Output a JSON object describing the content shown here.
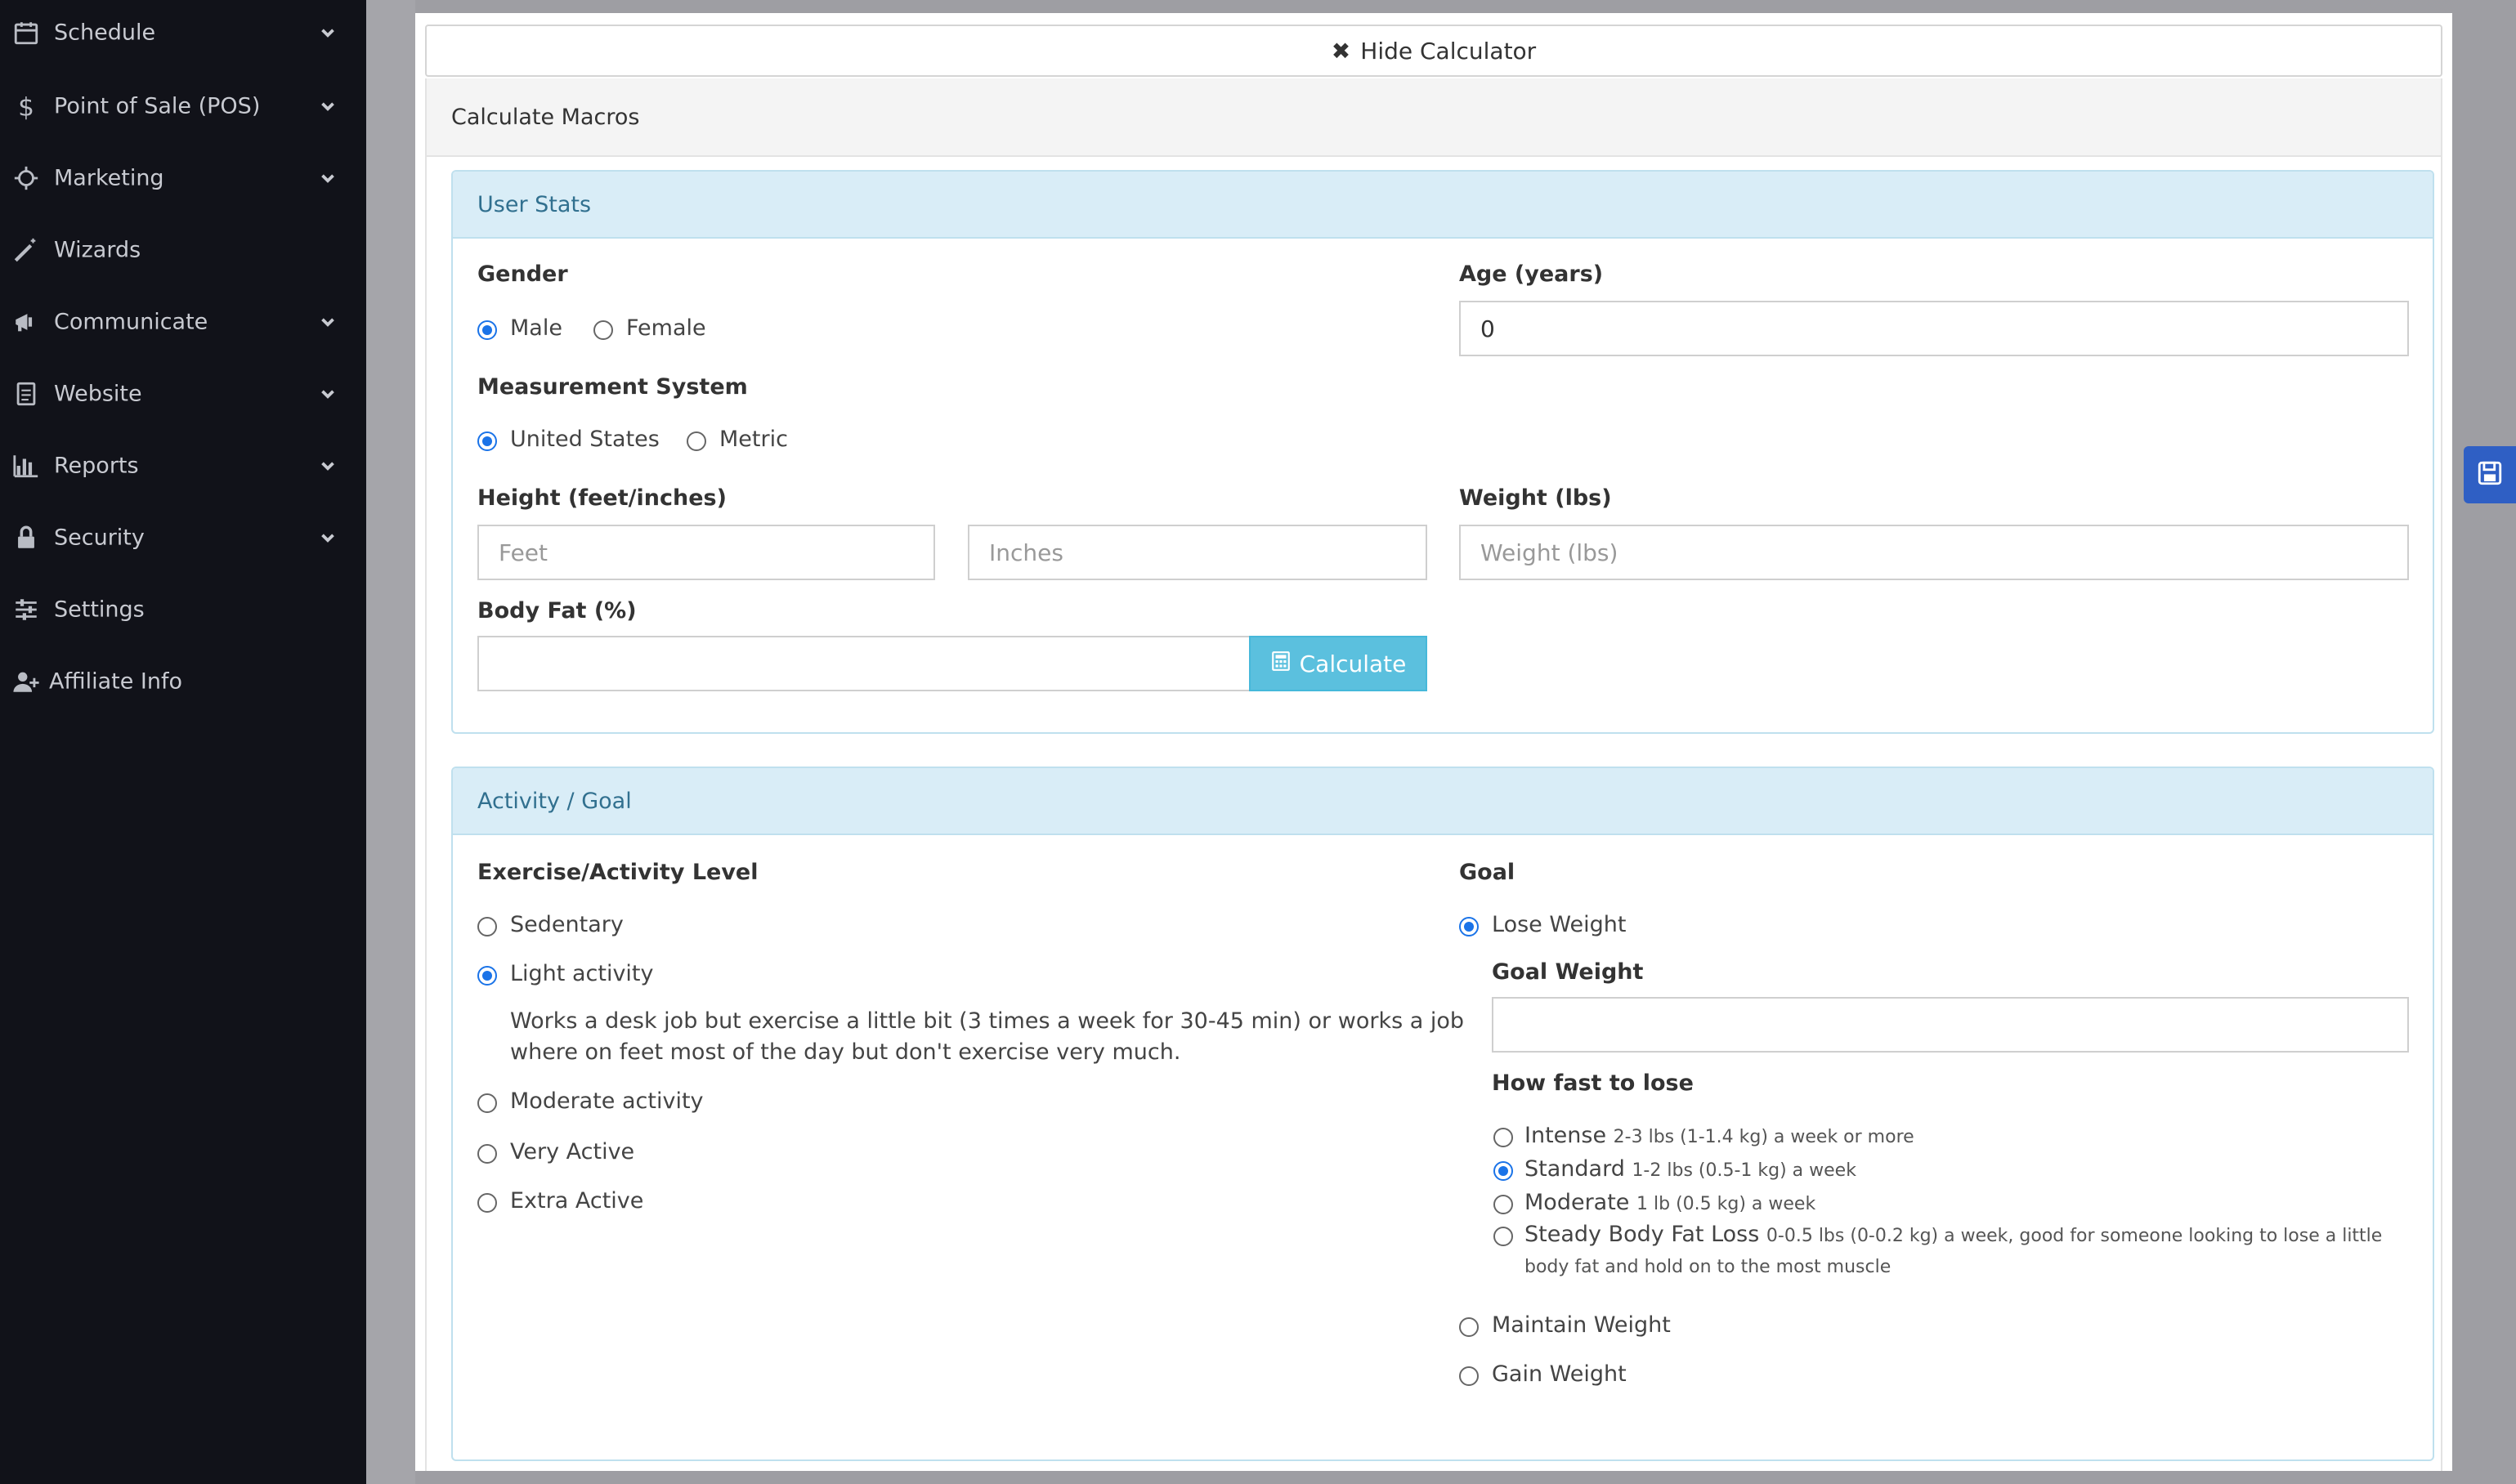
{
  "sidebar": {
    "items": [
      {
        "label": "Schedule",
        "icon": "calendar-icon",
        "has_chevron": true
      },
      {
        "label": "Point of Sale (POS)",
        "icon": "dollar-icon",
        "has_chevron": true
      },
      {
        "label": "Marketing",
        "icon": "crosshair-icon",
        "has_chevron": true
      },
      {
        "label": "Wizards",
        "icon": "magic-wand-icon",
        "has_chevron": false
      },
      {
        "label": "Communicate",
        "icon": "megaphone-icon",
        "has_chevron": true
      },
      {
        "label": "Website",
        "icon": "document-icon",
        "has_chevron": true
      },
      {
        "label": "Reports",
        "icon": "bar-chart-icon",
        "has_chevron": true
      },
      {
        "label": "Security",
        "icon": "lock-icon",
        "has_chevron": true
      },
      {
        "label": "Settings",
        "icon": "sliders-icon",
        "has_chevron": false
      },
      {
        "label": "Affiliate Info",
        "icon": "user-plus-icon",
        "has_chevron": false
      }
    ]
  },
  "modal": {
    "hide_label": "Hide Calculator",
    "title": "Calculate Macros"
  },
  "user_stats": {
    "heading": "User Stats",
    "gender_label": "Gender",
    "gender_options": [
      "Male",
      "Female"
    ],
    "gender_selected": "Male",
    "age_label": "Age (years)",
    "age_value": "0",
    "measurement_label": "Measurement System",
    "measurement_options": [
      "United States",
      "Metric"
    ],
    "measurement_selected": "United States",
    "height_label": "Height (feet/inches)",
    "feet_placeholder": "Feet",
    "inches_placeholder": "Inches",
    "weight_label": "Weight (lbs)",
    "weight_placeholder": "Weight (lbs)",
    "bodyfat_label": "Body Fat (%)",
    "bodyfat_value": "",
    "calculate_label": "Calculate"
  },
  "activity": {
    "heading": "Activity / Goal",
    "level_label": "Exercise/Activity Level",
    "levels": [
      "Sedentary",
      "Light activity",
      "Moderate activity",
      "Very Active",
      "Extra Active"
    ],
    "selected": "Light activity",
    "light_desc_line1": "Works a desk job but exercise a little bit (3 times a week for 30-45 min) or works a job",
    "light_desc_line2": "where on feet most of the day but don't exercise very much.",
    "goal_label": "Goal",
    "goals": [
      "Lose Weight",
      "Maintain Weight",
      "Gain Weight"
    ],
    "goal_selected": "Lose Weight",
    "goal_weight_label": "Goal Weight",
    "goal_weight_value": "",
    "how_fast_label": "How fast to lose",
    "speeds": [
      {
        "name": "Intense",
        "desc": "2-3 lbs (1-1.4 kg) a week or more"
      },
      {
        "name": "Standard",
        "desc": "1-2 lbs (0.5-1 kg) a week"
      },
      {
        "name": "Moderate",
        "desc": "1 lb (0.5 kg) a week"
      },
      {
        "name": "Steady Body Fat Loss",
        "desc": "0-0.5 lbs (0-0.2 kg) a week, good for someone looking to lose a little",
        "desc2": "body fat and hold on to the most muscle"
      }
    ],
    "speed_selected": "Standard"
  },
  "colors": {
    "sidebar_bg": "#111219",
    "panel_head_bg": "#d9edf7",
    "panel_head_text": "#31708f",
    "calc_button": "#5bc0de",
    "radio_accent": "#1a73e8",
    "save_tab": "#2f5fc4"
  }
}
